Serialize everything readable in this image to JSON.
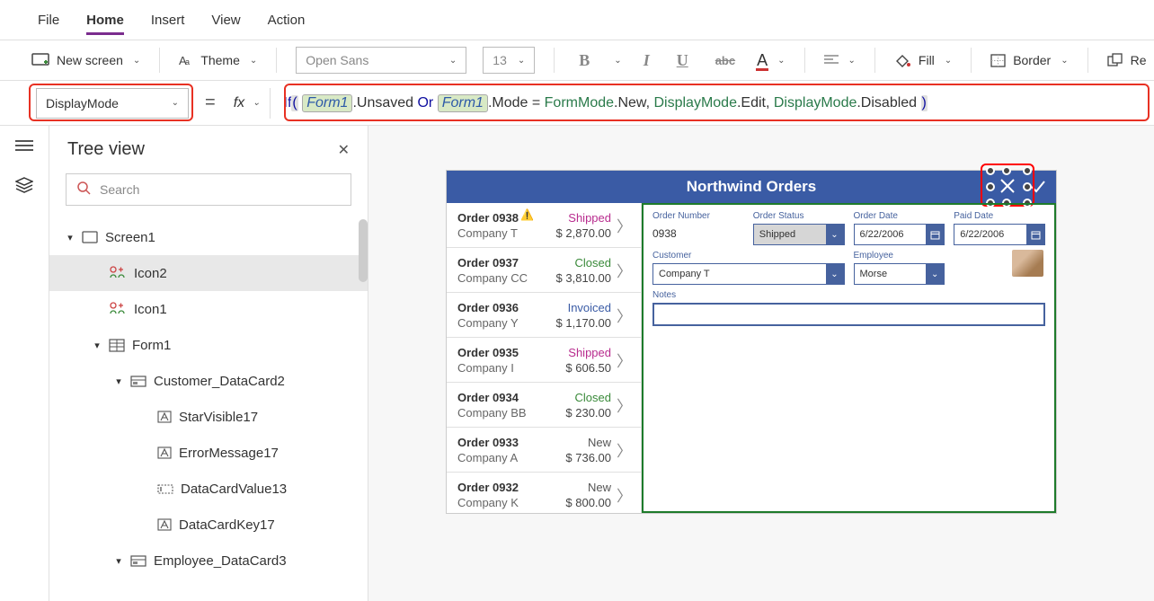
{
  "menu": {
    "file": "File",
    "home": "Home",
    "insert": "Insert",
    "view": "View",
    "action": "Action"
  },
  "toolbar": {
    "new_screen": "New screen",
    "theme": "Theme",
    "font_name": "Open Sans",
    "font_size": "13",
    "bold": "B",
    "italic": "I",
    "underline": "U",
    "strike": "abc",
    "fontcolor": "A",
    "fill": "Fill",
    "border": "Border",
    "reorder": "Re"
  },
  "property_selector": "DisplayMode",
  "formula": {
    "fn_if": "If",
    "ref1": "Form1",
    "unsaved": ".Unsaved ",
    "or": "Or",
    "ref2": "Form1",
    "mode": ".Mode = ",
    "type1": "FormMode",
    "new": ".New, ",
    "type2": "DisplayMode",
    "edit": ".Edit, ",
    "type3": "DisplayMode",
    "disabled": ".Disabled "
  },
  "tree": {
    "title": "Tree view",
    "search_placeholder": "Search",
    "items": [
      {
        "id": "screen1",
        "label": "Screen1",
        "indent": 1,
        "caret": "▾",
        "icon": "screen"
      },
      {
        "id": "icon2",
        "label": "Icon2",
        "indent": 2,
        "icon": "looseicon",
        "selected": true
      },
      {
        "id": "icon1",
        "label": "Icon1",
        "indent": 2,
        "icon": "looseicon"
      },
      {
        "id": "form1",
        "label": "Form1",
        "indent": 3,
        "caret": "▾",
        "icon": "form"
      },
      {
        "id": "cust",
        "label": "Customer_DataCard2",
        "indent": 4,
        "caret": "▾",
        "icon": "card"
      },
      {
        "id": "star17",
        "label": "StarVisible17",
        "indent": 5,
        "icon": "label"
      },
      {
        "id": "err17",
        "label": "ErrorMessage17",
        "indent": 5,
        "icon": "label"
      },
      {
        "id": "dcv13",
        "label": "DataCardValue13",
        "indent": 5,
        "icon": "input"
      },
      {
        "id": "dck17",
        "label": "DataCardKey17",
        "indent": 5,
        "icon": "label"
      },
      {
        "id": "emp",
        "label": "Employee_DataCard3",
        "indent": 4,
        "caret": "▾",
        "icon": "card"
      }
    ]
  },
  "app": {
    "title": "Northwind Orders",
    "orders": [
      {
        "no": "Order 0938",
        "co": "Company T",
        "status": "Shipped",
        "cls": "st-shipped",
        "amt": "$ 2,870.00",
        "warn": true
      },
      {
        "no": "Order 0937",
        "co": "Company CC",
        "status": "Closed",
        "cls": "st-closed",
        "amt": "$ 3,810.00"
      },
      {
        "no": "Order 0936",
        "co": "Company Y",
        "status": "Invoiced",
        "cls": "st-invoiced",
        "amt": "$ 1,170.00"
      },
      {
        "no": "Order 0935",
        "co": "Company I",
        "status": "Shipped",
        "cls": "st-shipped",
        "amt": "$ 606.50"
      },
      {
        "no": "Order 0934",
        "co": "Company BB",
        "status": "Closed",
        "cls": "st-closed",
        "amt": "$ 230.00"
      },
      {
        "no": "Order 0933",
        "co": "Company A",
        "status": "New",
        "cls": "st-new",
        "amt": "$ 736.00"
      },
      {
        "no": "Order 0932",
        "co": "Company K",
        "status": "New",
        "cls": "st-new",
        "amt": "$ 800.00"
      }
    ],
    "form": {
      "order_number_lbl": "Order Number",
      "order_number_val": "0938",
      "order_status_lbl": "Order Status",
      "order_status_val": "Shipped",
      "order_date_lbl": "Order Date",
      "order_date_val": "6/22/2006",
      "paid_date_lbl": "Paid Date",
      "paid_date_val": "6/22/2006",
      "customer_lbl": "Customer",
      "customer_val": "Company T",
      "employee_lbl": "Employee",
      "employee_val": "Morse",
      "notes_lbl": "Notes"
    }
  }
}
